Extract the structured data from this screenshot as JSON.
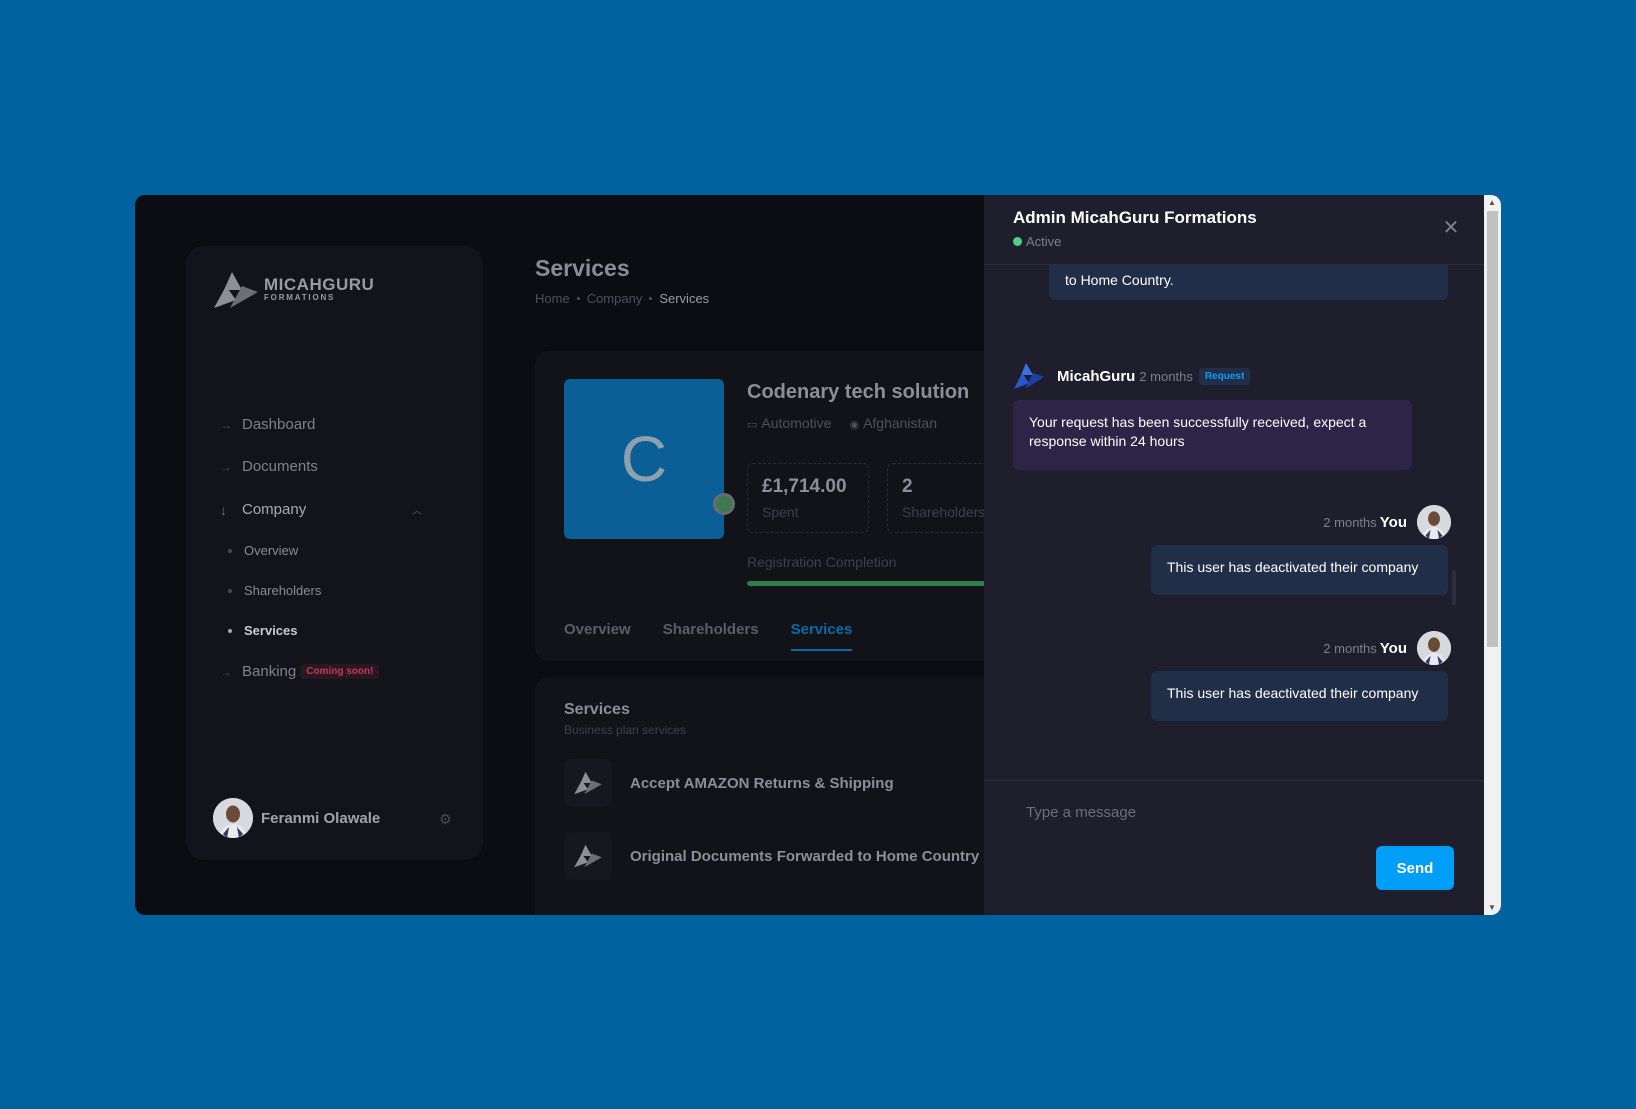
{
  "brand": {
    "name": "MICAHGURU",
    "tagline": "FORMATIONS"
  },
  "sidebar": {
    "items": [
      {
        "label": "Dashboard",
        "icon": "arrow-right-icon"
      },
      {
        "label": "Documents",
        "icon": "arrow-right-icon"
      },
      {
        "label": "Company",
        "icon": "arrow-down-icon",
        "expanded": true,
        "children": [
          {
            "label": "Overview"
          },
          {
            "label": "Shareholders"
          },
          {
            "label": "Services",
            "active": true
          }
        ]
      },
      {
        "label": "Banking",
        "icon": "arrow-right-icon",
        "badge": "Coming soon!"
      }
    ],
    "user": {
      "name": "Feranmi Olawale"
    }
  },
  "page": {
    "title": "Services",
    "breadcrumb": [
      "Home",
      "Company",
      "Services"
    ]
  },
  "company": {
    "initial": "C",
    "name": "Codenary tech solution",
    "industry": "Automotive",
    "country": "Afghanistan",
    "stats": [
      {
        "value": "£1,714.00",
        "label": "Spent"
      },
      {
        "value": "2",
        "label": "Shareholders"
      }
    ],
    "registration_label": "Registration Completion",
    "registration_progress": 1.0,
    "tabs": [
      {
        "label": "Overview"
      },
      {
        "label": "Shareholders"
      },
      {
        "label": "Services",
        "active": true
      }
    ]
  },
  "services": {
    "title": "Services",
    "subtitle": "Business plan services",
    "items": [
      {
        "name": "Accept AMAZON Returns & Shipping"
      },
      {
        "name": "Original Documents Forwarded to Home Country"
      }
    ]
  },
  "chat": {
    "title": "Admin MicahGuru Formations",
    "status": "Active",
    "messages": [
      {
        "direction": "out",
        "text": "to Home Country."
      },
      {
        "direction": "in",
        "sender": "MicahGuru",
        "time": "2 months",
        "badge": "Request",
        "text": "Your request has been successfully received, expect a response within 24 hours"
      },
      {
        "direction": "out",
        "sender": "You",
        "time": "2 months",
        "text": "This user has deactivated their company"
      },
      {
        "direction": "out",
        "sender": "You",
        "time": "2 months",
        "text": "This user has deactivated their company"
      }
    ],
    "input_placeholder": "Type a message",
    "send_label": "Send"
  },
  "colors": {
    "page_bg": "#0063a0",
    "accent": "#009ef7",
    "active_green": "#50cd89",
    "danger": "#c03a55"
  }
}
